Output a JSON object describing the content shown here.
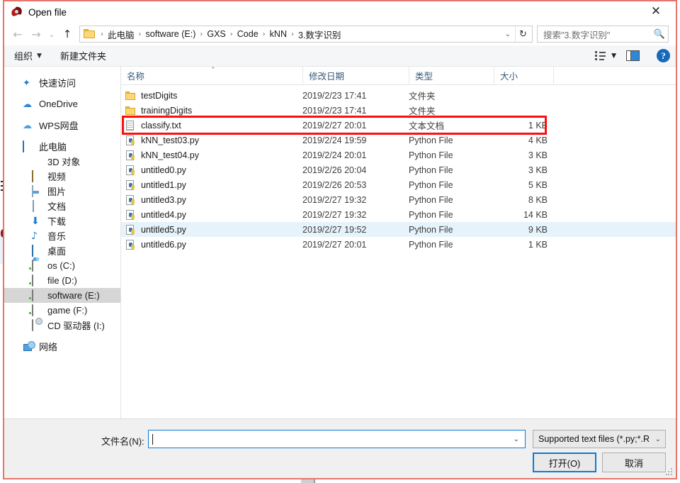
{
  "window": {
    "title": "Open file",
    "app_icon": "spyder-icon",
    "close_label": "✕",
    "border_color": "#e8756b"
  },
  "nav": {
    "back_label": "←",
    "forward_label": "→",
    "history_label": "⌄",
    "up_label": "↑",
    "refresh_label": "↻",
    "dropdown_label": "⌄",
    "separator": "›",
    "breadcrumbs": [
      "此电脑",
      "software (E:)",
      "GXS",
      "Code",
      "kNN",
      "3.数字识别"
    ]
  },
  "search": {
    "placeholder": "搜索\"3.数字识别\"",
    "icon": "search-icon"
  },
  "commandbar": {
    "organize_label": "组织",
    "organize_caret": "▼",
    "new_folder_label": "新建文件夹",
    "view_caret": "▼",
    "help_label": "?"
  },
  "sidebar": {
    "items": [
      {
        "label": "快速访问",
        "icon": "star-icon",
        "level": 0,
        "selected": false,
        "gap_before": false
      },
      {
        "label": "OneDrive",
        "icon": "cloud-icon",
        "level": 0,
        "selected": false,
        "gap_before": true
      },
      {
        "label": "WPS网盘",
        "icon": "cloud-outline-icon",
        "level": 0,
        "selected": false,
        "gap_before": true
      },
      {
        "label": "此电脑",
        "icon": "this-pc-icon",
        "level": 0,
        "selected": false,
        "gap_before": true
      },
      {
        "label": "3D 对象",
        "icon": "3d-objects-icon",
        "level": 1,
        "selected": false,
        "gap_before": false
      },
      {
        "label": "视频",
        "icon": "videos-icon",
        "level": 1,
        "selected": false,
        "gap_before": false
      },
      {
        "label": "图片",
        "icon": "pictures-icon",
        "level": 1,
        "selected": false,
        "gap_before": false
      },
      {
        "label": "文档",
        "icon": "documents-icon",
        "level": 1,
        "selected": false,
        "gap_before": false
      },
      {
        "label": "下载",
        "icon": "downloads-icon",
        "level": 1,
        "selected": false,
        "gap_before": false
      },
      {
        "label": "音乐",
        "icon": "music-icon",
        "level": 1,
        "selected": false,
        "gap_before": false
      },
      {
        "label": "桌面",
        "icon": "desktop-icon",
        "level": 1,
        "selected": false,
        "gap_before": false
      },
      {
        "label": "os (C:)",
        "icon": "os-drive-icon",
        "level": 1,
        "selected": false,
        "gap_before": false
      },
      {
        "label": "file (D:)",
        "icon": "drive-icon",
        "level": 1,
        "selected": false,
        "gap_before": false
      },
      {
        "label": "software (E:)",
        "icon": "drive-icon",
        "level": 1,
        "selected": true,
        "gap_before": false
      },
      {
        "label": "game (F:)",
        "icon": "drive-icon",
        "level": 1,
        "selected": false,
        "gap_before": false
      },
      {
        "label": "CD 驱动器 (I:)",
        "icon": "cd-drive-icon",
        "level": 1,
        "selected": false,
        "gap_before": false
      },
      {
        "label": "网络",
        "icon": "network-icon",
        "level": 0,
        "selected": false,
        "gap_before": true
      }
    ]
  },
  "filelist": {
    "columns": [
      {
        "label": "名称",
        "key": "name"
      },
      {
        "label": "修改日期",
        "key": "date"
      },
      {
        "label": "类型",
        "key": "type"
      },
      {
        "label": "大小",
        "key": "size"
      }
    ],
    "sort_column": "名称",
    "sort_caret": "⌃",
    "highlight_color": "#fb0f0f",
    "rows": [
      {
        "name": "testDigits",
        "date": "2019/2/23 17:41",
        "type": "文件夹",
        "size": "",
        "icon": "folder-icon",
        "selected": false,
        "annotated": false
      },
      {
        "name": "trainingDigits",
        "date": "2019/2/23 17:41",
        "type": "文件夹",
        "size": "",
        "icon": "folder-icon",
        "selected": false,
        "annotated": false
      },
      {
        "name": "classify.txt",
        "date": "2019/2/27 20:01",
        "type": "文本文档",
        "size": "1 KB",
        "icon": "text-file-icon",
        "selected": false,
        "annotated": true
      },
      {
        "name": "kNN_test03.py",
        "date": "2019/2/24 19:59",
        "type": "Python File",
        "size": "4 KB",
        "icon": "python-file-icon",
        "selected": false,
        "annotated": false
      },
      {
        "name": "kNN_test04.py",
        "date": "2019/2/24 20:01",
        "type": "Python File",
        "size": "3 KB",
        "icon": "python-file-icon",
        "selected": false,
        "annotated": false
      },
      {
        "name": "untitled0.py",
        "date": "2019/2/26 20:04",
        "type": "Python File",
        "size": "3 KB",
        "icon": "python-file-icon",
        "selected": false,
        "annotated": false
      },
      {
        "name": "untitled1.py",
        "date": "2019/2/26 20:53",
        "type": "Python File",
        "size": "5 KB",
        "icon": "python-file-icon",
        "selected": false,
        "annotated": false
      },
      {
        "name": "untitled3.py",
        "date": "2019/2/27 19:32",
        "type": "Python File",
        "size": "8 KB",
        "icon": "python-file-icon",
        "selected": false,
        "annotated": false
      },
      {
        "name": "untitled4.py",
        "date": "2019/2/27 19:32",
        "type": "Python File",
        "size": "14 KB",
        "icon": "python-file-icon",
        "selected": false,
        "annotated": false
      },
      {
        "name": "untitled5.py",
        "date": "2019/2/27 19:52",
        "type": "Python File",
        "size": "9 KB",
        "icon": "python-file-icon",
        "selected": true,
        "annotated": false
      },
      {
        "name": "untitled6.py",
        "date": "2019/2/27 20:01",
        "type": "Python File",
        "size": "1 KB",
        "icon": "python-file-icon",
        "selected": false,
        "annotated": false
      }
    ]
  },
  "footer": {
    "filename_label": "文件名(N):",
    "filename_value": "",
    "filename_caret": "⌄",
    "filter_value": "Supported text files (*.py;*.R",
    "filter_caret": "⌄",
    "open_button": "打开(O)",
    "cancel_button": "取消"
  }
}
